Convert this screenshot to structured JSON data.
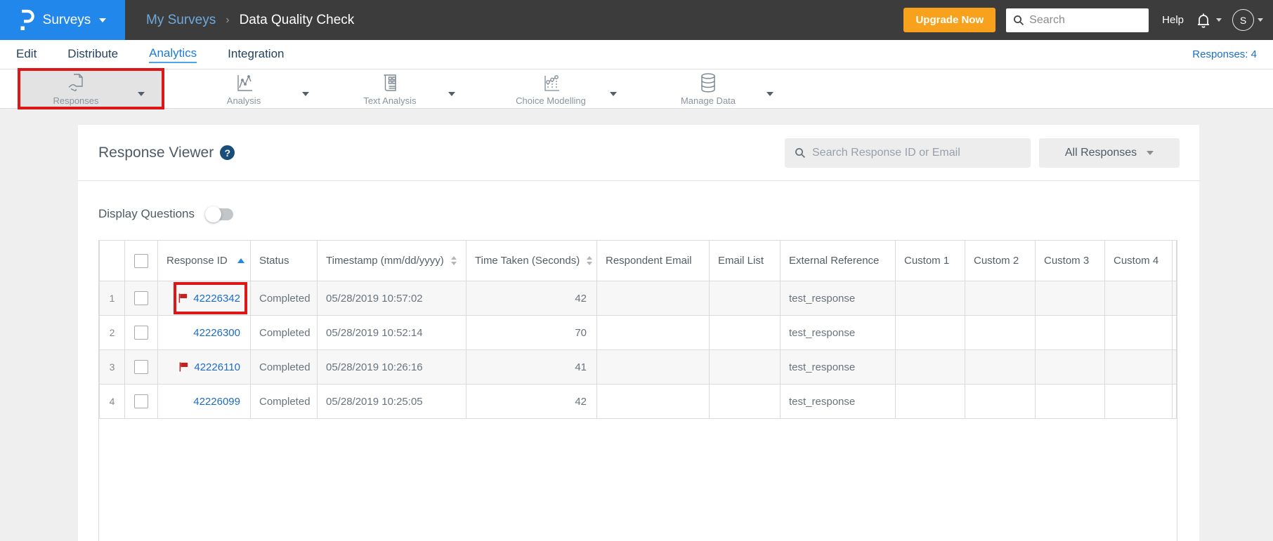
{
  "colors": {
    "accent_blue": "#2187ea",
    "topbar_dark": "#3c3c3c",
    "upgrade_orange": "#f7a11c",
    "link_blue": "#1c6cc2",
    "flag_red": "#c51f1f",
    "annotation_red": "#dd1717",
    "active_tab_blue": "#1d7ad4"
  },
  "topbar": {
    "product_name": "Surveys",
    "breadcrumb": {
      "parent": "My Surveys",
      "separator": "›",
      "current": "Data Quality Check"
    },
    "upgrade_label": "Upgrade Now",
    "search_placeholder": "Search",
    "help_label": "Help",
    "avatar_initial": "S"
  },
  "nav": {
    "tabs": [
      {
        "label": "Edit",
        "active": false
      },
      {
        "label": "Distribute",
        "active": false
      },
      {
        "label": "Analytics",
        "active": true
      },
      {
        "label": "Integration",
        "active": false
      }
    ],
    "responses_count_label": "Responses: 4"
  },
  "toolbar": {
    "items": [
      {
        "label": "Responses",
        "icon": "responses-icon",
        "active": true,
        "annotated": true
      },
      {
        "label": "Analysis",
        "icon": "analysis-icon",
        "active": false
      },
      {
        "label": "Text Analysis",
        "icon": "text-analysis-icon",
        "active": false
      },
      {
        "label": "Choice Modelling",
        "icon": "choice-modelling-icon",
        "active": false
      },
      {
        "label": "Manage Data",
        "icon": "manage-data-icon",
        "active": false
      }
    ]
  },
  "viewer": {
    "title": "Response Viewer",
    "help_icon": "?",
    "search_placeholder": "Search Response ID or Email",
    "filter_value": "All Responses",
    "display_questions_label": "Display Questions",
    "display_questions_state": "off"
  },
  "table": {
    "columns": [
      {
        "label": "",
        "key": "rownum"
      },
      {
        "label": "",
        "key": "checkbox"
      },
      {
        "label": "Response ID",
        "key": "response_id",
        "sort": "asc"
      },
      {
        "label": "Status",
        "key": "status"
      },
      {
        "label": "Timestamp (mm/dd/yyyy)",
        "key": "timestamp",
        "sort": "both"
      },
      {
        "label": "Time Taken (Seconds)",
        "key": "time_taken",
        "sort": "both"
      },
      {
        "label": "Respondent Email",
        "key": "respondent_email"
      },
      {
        "label": "Email List",
        "key": "email_list"
      },
      {
        "label": "External Reference",
        "key": "external_reference"
      },
      {
        "label": "Custom 1",
        "key": "custom_1"
      },
      {
        "label": "Custom 2",
        "key": "custom_2"
      },
      {
        "label": "Custom 3",
        "key": "custom_3"
      },
      {
        "label": "Custom 4",
        "key": "custom_4"
      },
      {
        "label": "",
        "key": "spacer"
      }
    ],
    "rows": [
      {
        "num": "1",
        "response_id": "42226342",
        "flagged": true,
        "annotated": true,
        "status": "Completed",
        "timestamp": "05/28/2019 10:57:02",
        "time_taken": "42",
        "respondent_email": "",
        "email_list": "",
        "external_reference": "test_response",
        "custom_1": "",
        "custom_2": "",
        "custom_3": "",
        "custom_4": ""
      },
      {
        "num": "2",
        "response_id": "42226300",
        "flagged": false,
        "annotated": false,
        "status": "Completed",
        "timestamp": "05/28/2019 10:52:14",
        "time_taken": "70",
        "respondent_email": "",
        "email_list": "",
        "external_reference": "test_response",
        "custom_1": "",
        "custom_2": "",
        "custom_3": "",
        "custom_4": ""
      },
      {
        "num": "3",
        "response_id": "42226110",
        "flagged": true,
        "annotated": false,
        "status": "Completed",
        "timestamp": "05/28/2019 10:26:16",
        "time_taken": "41",
        "respondent_email": "",
        "email_list": "",
        "external_reference": "test_response",
        "custom_1": "",
        "custom_2": "",
        "custom_3": "",
        "custom_4": ""
      },
      {
        "num": "4",
        "response_id": "42226099",
        "flagged": false,
        "annotated": false,
        "status": "Completed",
        "timestamp": "05/28/2019 10:25:05",
        "time_taken": "42",
        "respondent_email": "",
        "email_list": "",
        "external_reference": "test_response",
        "custom_1": "",
        "custom_2": "",
        "custom_3": "",
        "custom_4": ""
      }
    ]
  }
}
